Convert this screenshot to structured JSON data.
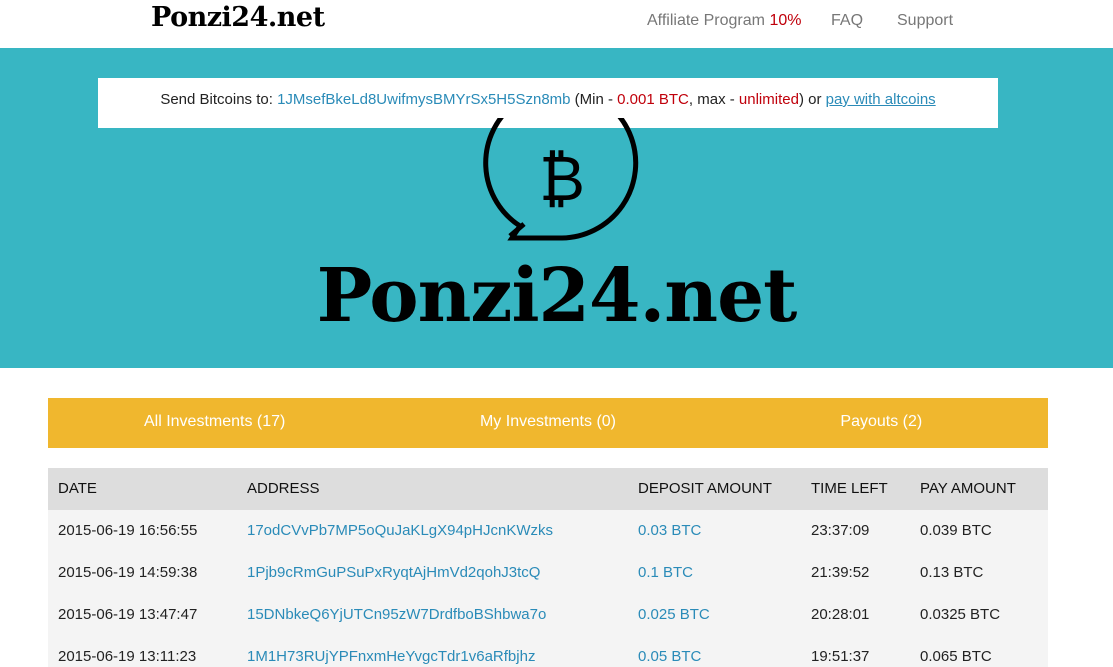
{
  "nav": {
    "brand": "Ponzi24.net",
    "affiliate_label": "Affiliate Program",
    "affiliate_pct": "10%",
    "faq": "FAQ",
    "support": "Support"
  },
  "send": {
    "prefix": "Send Bitcoins to:",
    "address": "1JMsefBkeLd8UwifmysBMYrSx5H5Szn8mb",
    "min_open": "(Min -",
    "min_value": "0.001 BTC",
    "max_label": ", max -",
    "max_value": "unlimited",
    "or_label": ") or",
    "alt_link": "pay with altcoins"
  },
  "hero": {
    "title": "Ponzi24.net",
    "logo_icon": "bitcoin-speech-bubble-icon"
  },
  "tabs": [
    {
      "label": "All Investments (17)"
    },
    {
      "label": "My Investments (0)"
    },
    {
      "label": "Payouts (2)"
    }
  ],
  "table": {
    "headers": [
      "DATE",
      "ADDRESS",
      "DEPOSIT AMOUNT",
      "TIME LEFT",
      "PAY AMOUNT"
    ],
    "rows": [
      [
        "2015-06-19 16:56:55",
        "17odCVvPb7MP5oQuJaKLgX94pHJcnKWzks",
        "0.03 BTC",
        "23:37:09",
        "0.039 BTC"
      ],
      [
        "2015-06-19 14:59:38",
        "1Pjb9cRmGuPSuPxRyqtAjHmVd2qohJ3tcQ",
        "0.1 BTC",
        "21:39:52",
        "0.13 BTC"
      ],
      [
        "2015-06-19 13:47:47",
        "15DNbkeQ6YjUTCn95zW7DrdfboBShbwa7o",
        "0.025 BTC",
        "20:28:01",
        "0.0325 BTC"
      ],
      [
        "2015-06-19 13:11:23",
        "1M1H73RUjYPFnxmHeYvgcTdr1v6aRfbjhz",
        "0.05 BTC",
        "19:51:37",
        "0.065 BTC"
      ]
    ]
  },
  "colors": {
    "teal": "#38b6c3",
    "yellow": "#f0b72e",
    "red": "#c0000b",
    "link": "#2a8bb8"
  }
}
